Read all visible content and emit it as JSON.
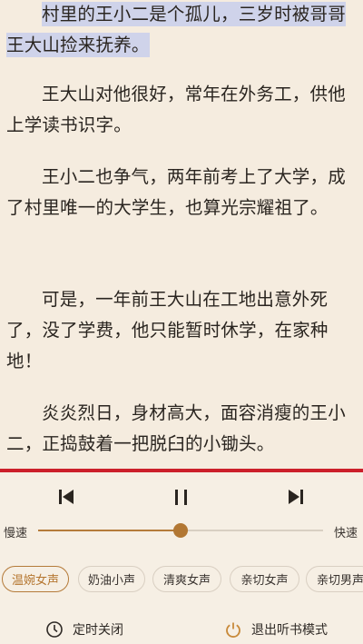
{
  "reader": {
    "paragraphs": [
      "村里的王小二是个孤儿，三岁时被哥哥王大山捡来抚养。",
      "王大山对他很好，常年在外务工，供他上学读书识字。",
      "王小二也争气，两年前考上了大学，成了村里唯一的大学生，也算光宗耀祖了。",
      "可是，一年前王大山在工地出意外死了，没了学费，他只能暂时休学，在家种地！",
      "炎炎烈日，身材高大，面容消瘦的王小二，正捣鼓着一把脱臼的小锄头。"
    ]
  },
  "player": {
    "progress_fraction": 0.5,
    "speed_slow_label": "慢速",
    "speed_fast_label": "快速",
    "speed_value_fraction": 0.5,
    "voices": [
      {
        "label": "温婉女声",
        "active": true
      },
      {
        "label": "奶油小声",
        "active": false
      },
      {
        "label": "清爽女声",
        "active": false
      },
      {
        "label": "亲切女声",
        "active": false
      },
      {
        "label": "亲切男声",
        "active": false
      }
    ],
    "timer_label": "定时关闭",
    "exit_label": "退出听书模式"
  },
  "colors": {
    "accent": "#b57b3a",
    "divider": "#cc1f2a",
    "highlight": "#cfd3ea",
    "background": "#f5ecdf"
  },
  "icons": {
    "prev": "skip-previous-icon",
    "pause": "pause-icon",
    "next": "skip-next-icon",
    "timer": "clock-icon",
    "exit": "power-icon"
  }
}
